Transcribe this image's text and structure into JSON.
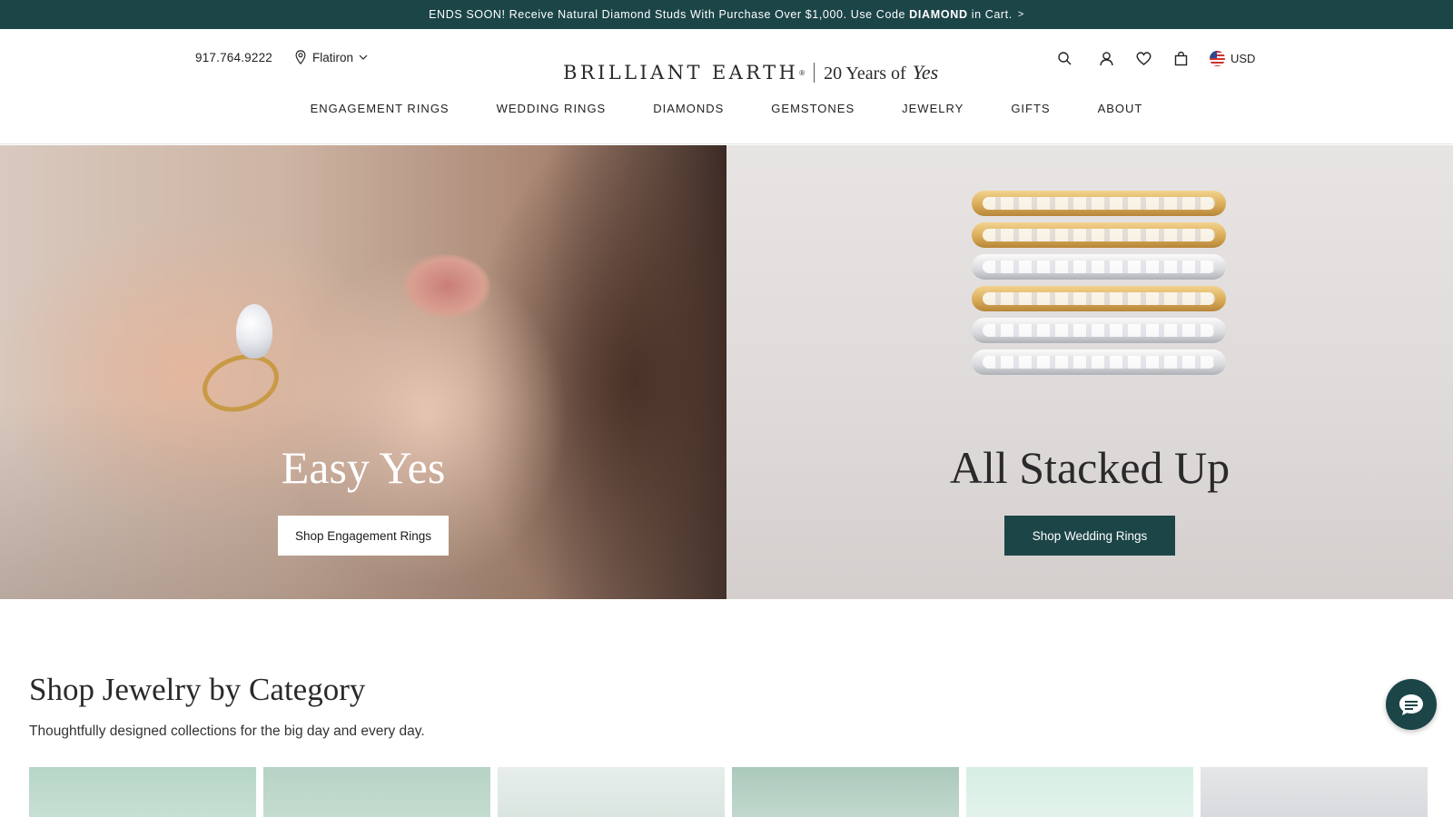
{
  "promo": {
    "text_before": "ENDS SOON! Receive Natural Diamond Studs With Purchase Over $1,000. Use Code",
    "code": "DIAMOND",
    "text_after": "in Cart.",
    "chevron": ">"
  },
  "header": {
    "phone": "917.764.9222",
    "store": "Flatiron",
    "logo_word": "BRILLIANT EARTH",
    "logo_tag": "20 Years of",
    "logo_tag_script": "Yes",
    "currency": "USD"
  },
  "nav": {
    "items": [
      "ENGAGEMENT RINGS",
      "WEDDING RINGS",
      "DIAMONDS",
      "GEMSTONES",
      "JEWELRY",
      "GIFTS",
      "ABOUT"
    ]
  },
  "hero": {
    "left": {
      "title": "Easy Yes",
      "button": "Shop Engagement Rings"
    },
    "right": {
      "title": "All Stacked Up",
      "button": "Shop Wedding Rings"
    }
  },
  "category": {
    "title": "Shop Jewelry by Category",
    "subtitle": "Thoughtfully designed collections for the big day and every day."
  },
  "icons": [
    "map-pin-icon",
    "chevron-down-icon",
    "search-icon",
    "account-icon",
    "heart-icon",
    "bag-icon",
    "us-flag-icon",
    "chat-icon"
  ],
  "colors": {
    "brand": "#1c4548",
    "text": "#222222",
    "background": "#ffffff"
  }
}
